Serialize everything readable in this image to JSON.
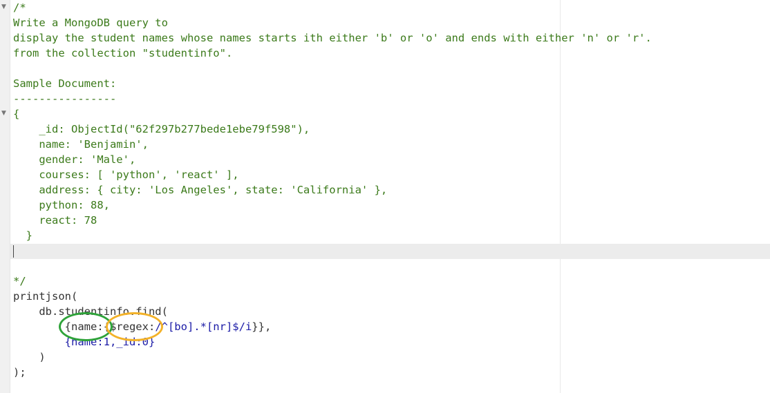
{
  "editor": {
    "lines": [
      "/*",
      "Write a MongoDB query to",
      "display the student names whose names starts ith either 'b' or 'o' and ends with either 'n' or 'r'.",
      "from the collection \"studentinfo\".",
      "",
      "Sample Document:",
      "----------------",
      "{",
      "    _id: ObjectId(\"62f297b277bede1ebe79f598\"),",
      "    name: 'Benjamin',",
      "    gender: 'Male',",
      "    courses: [ 'python', 'react' ],",
      "    address: { city: 'Los Angeles', state: 'California' },",
      "    python: 88,",
      "    react: 78",
      "  }",
      "",
      "",
      "*/",
      "printjson(",
      "    db.studentinfo.find(",
      "        {name:{$regex:",
      "/^[bo].*[nr]$/i",
      "}},",
      "        {name:1,_id:0}",
      "    )",
      ");"
    ],
    "colors": {
      "comment": "#3b7a1a",
      "code": "#333333",
      "regex": "#1a1aa6",
      "highlight_green": "#2fa33a",
      "highlight_orange": "#f3b229"
    },
    "fold_icons": [
      "chevron-down-icon",
      "chevron-down-icon"
    ]
  }
}
